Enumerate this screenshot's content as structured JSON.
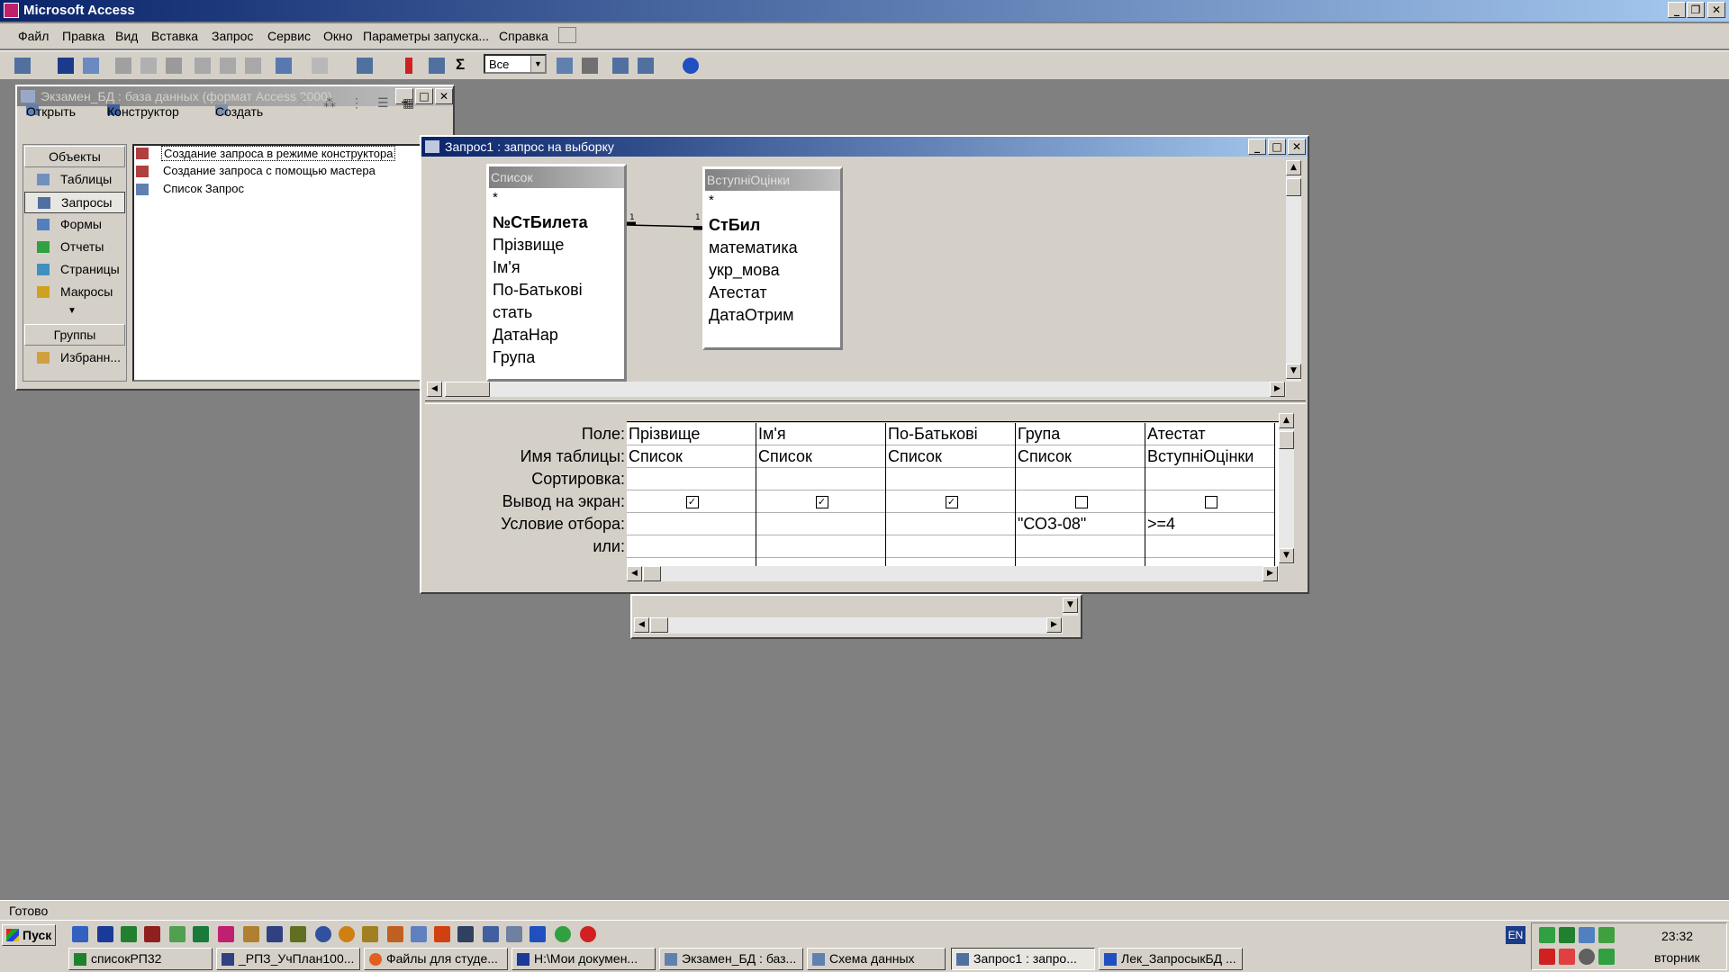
{
  "app": {
    "title": "Microsoft Access"
  },
  "menu": [
    "Файл",
    "Правка",
    "Вид",
    "Вставка",
    "Запрос",
    "Сервис",
    "Окно",
    "Параметры запуска...",
    "Справка"
  ],
  "toolbar": {
    "top_values": "Все"
  },
  "db_window": {
    "title": "Экзамен_БД : база данных (формат Access 2000)",
    "toolbar": {
      "open": "Открыть",
      "design": "Конструктор",
      "create": "Создать"
    },
    "objects_header": "Объекты",
    "objects": [
      "Таблицы",
      "Запросы",
      "Формы",
      "Отчеты",
      "Страницы",
      "Макросы"
    ],
    "groups_header": "Группы",
    "groups": [
      "Избранн..."
    ],
    "items": [
      "Создание запроса в режиме конструктора",
      "Создание запроса с помощью мастера",
      "Список Запрос"
    ]
  },
  "query_window": {
    "title": "Запрос1 : запрос на выборку",
    "tables": [
      {
        "name": "Список",
        "fields": [
          "*",
          "№СтБилета",
          "Прізвище",
          "Ім'я",
          "По-Батькові",
          "стать",
          "ДатаНар",
          "Група"
        ],
        "key": "№СтБилета"
      },
      {
        "name": "ВступніОцінки",
        "fields": [
          "*",
          "СтБил",
          "математика",
          "укр_мова",
          "Атестат",
          "ДатаОтрим"
        ],
        "key": "СтБил"
      }
    ],
    "relation": {
      "left": "1",
      "right": "1"
    },
    "row_labels": [
      "Поле:",
      "Имя таблицы:",
      "Сортировка:",
      "Вывод на экран:",
      "Условие отбора:",
      "или:"
    ],
    "columns": [
      {
        "field": "Прізвище",
        "table": "Список",
        "sort": "",
        "show": true,
        "criteria": "",
        "or": ""
      },
      {
        "field": "Ім'я",
        "table": "Список",
        "sort": "",
        "show": true,
        "criteria": "",
        "or": ""
      },
      {
        "field": "По-Батькові",
        "table": "Список",
        "sort": "",
        "show": true,
        "criteria": "",
        "or": ""
      },
      {
        "field": "Група",
        "table": "Список",
        "sort": "",
        "show": false,
        "criteria": "\"СОЗ-08\"",
        "or": ""
      },
      {
        "field": "Атестат",
        "table": "ВступніОцінки",
        "sort": "",
        "show": false,
        "criteria": ">=4",
        "or": ""
      }
    ]
  },
  "status": "Готово",
  "taskbar": {
    "start": "Пуск",
    "tasks": [
      "списокРП32",
      "_РПЗ_УчПлан100...",
      "Файлы для студе...",
      "H:\\Мои докумен...",
      "Экзамен_БД : баз...",
      "Схема данных",
      "Запрос1 : запро...",
      "Лек_ЗапросыкБД ..."
    ],
    "active_task": 6,
    "lang": "EN",
    "time": "23:32",
    "day": "вторник"
  },
  "colors": {
    "title_active": "#0a246a",
    "title_inactive": "#808080",
    "face": "#d4d0c8",
    "desktop": "#808080"
  }
}
